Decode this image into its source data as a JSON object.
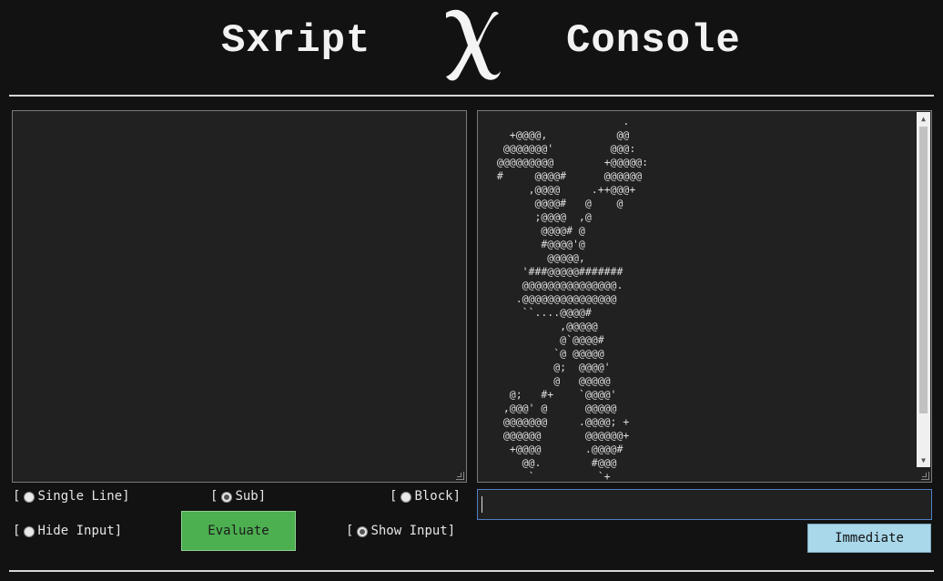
{
  "header": {
    "title_left": "Sxript",
    "title_right": "Console",
    "logo_icon": "fraktur-x-logo"
  },
  "output": {
    "ascii_art": "                     .\n   +@@@@,           @@\n  @@@@@@@'         @@@:\n @@@@@@@@@        +@@@@@:\n #     @@@@#      @@@@@@\n      ,@@@@     .++@@@+\n       @@@@#   @    @\n       ;@@@@  ,@\n        @@@@# @\n        #@@@@'@\n         @@@@@,\n     '###@@@@@#######\n     @@@@@@@@@@@@@@@.\n    .@@@@@@@@@@@@@@@\n     ``....@@@@#\n           ,@@@@@\n           @`@@@@#\n          `@ @@@@@\n          @;  @@@@'\n          @   @@@@@\n   @;   #+    `@@@@'\n  ,@@@' @      @@@@@\n  @@@@@@@     .@@@@; +\n  @@@@@@       @@@@@@+\n   +@@@@       .@@@@#\n     @@.        #@@@\n      `          `+"
  },
  "options": {
    "single_line": "Single Line",
    "sub": "Sub",
    "block": "Block",
    "hide_input": "Hide Input",
    "show_input": "Show Input",
    "bracket_open": "[",
    "bracket_close": "]",
    "selected_mode": "Sub",
    "selected_visibility": "Show Input"
  },
  "buttons": {
    "evaluate": "Evaluate",
    "immediate": "Immediate"
  },
  "immediate_input": {
    "value": ""
  },
  "colors": {
    "background": "#121212",
    "panel": "#212121",
    "evaluate": "#4caf50",
    "immediate": "#a9d8eb",
    "focus_border": "#4f7fc8"
  }
}
